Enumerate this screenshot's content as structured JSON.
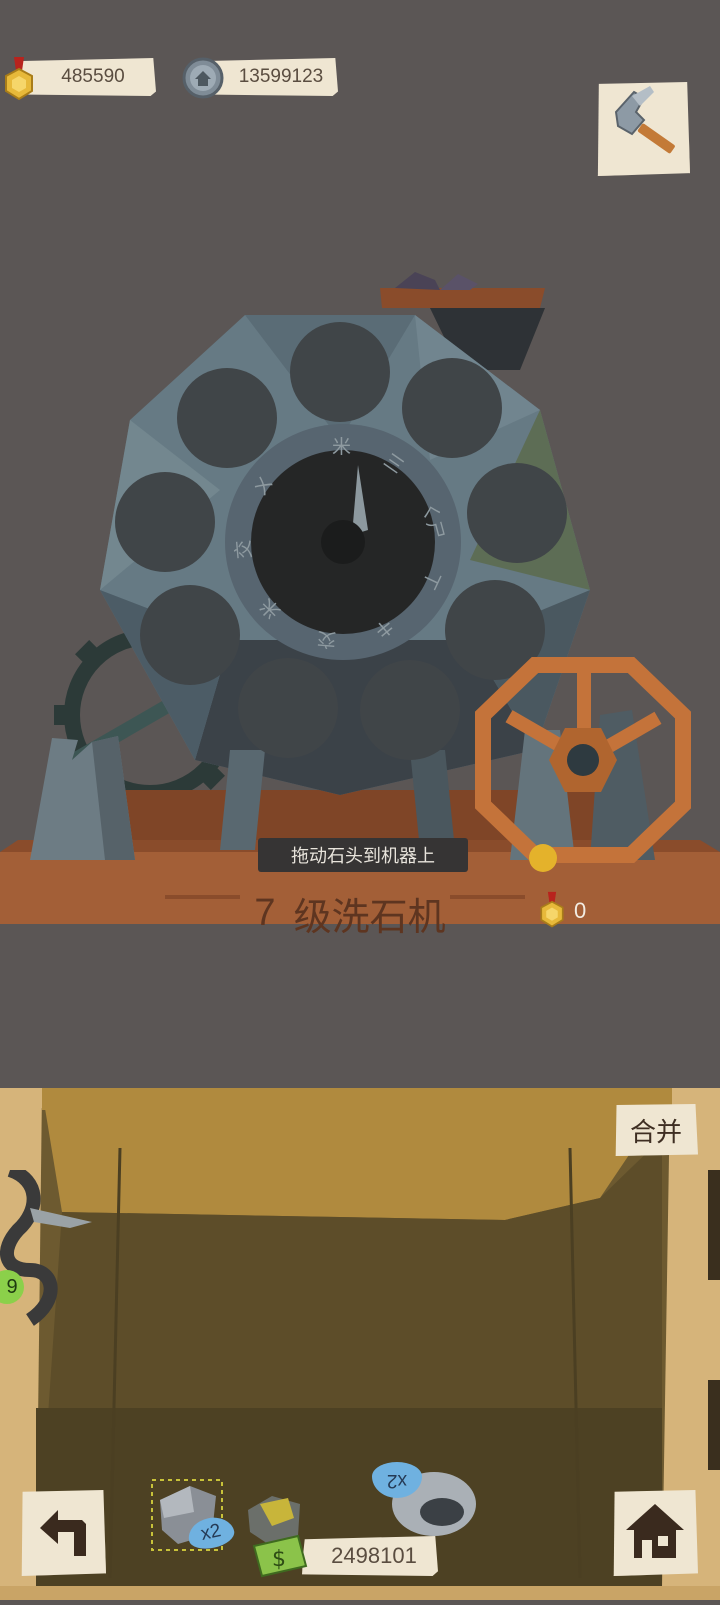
{
  "hud": {
    "medals": "485590",
    "coins": "13599123"
  },
  "machine": {
    "hint": "拖动石头到机器上",
    "level_number": "7",
    "name": "级洗石机",
    "medal_count": "0",
    "dial_glyphs": [
      "米",
      "三",
      "ㄑㄕ",
      "ㄒ",
      "キ",
      "交",
      "米",
      "交",
      "ㄨ"
    ]
  },
  "bag": {
    "merge_label": "合并",
    "side_badge": "9",
    "gem1_multiplier": "x2",
    "gem2_multiplier": "x2",
    "cash": "2498101"
  },
  "colors": {
    "background": "#5b5655",
    "wood": "#a35f37",
    "sand": "#d6b47a",
    "bag": "#6d5a30",
    "stone": "#3d4449"
  }
}
